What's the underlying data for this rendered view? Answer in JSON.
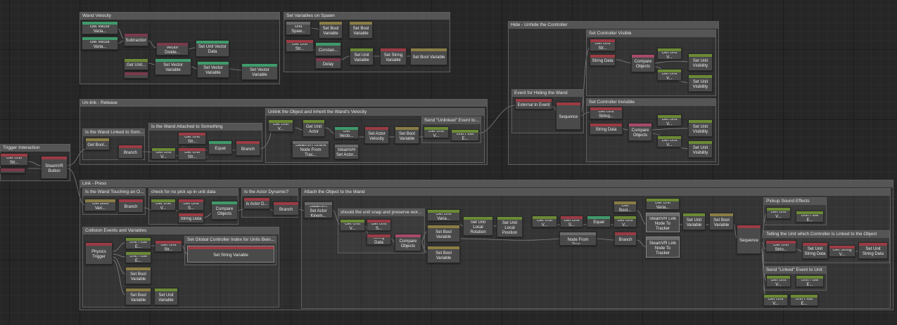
{
  "colors": {
    "green": "#3f9a6a",
    "lime": "#6b8a35",
    "olive": "#8a7d45",
    "red": "#9b3b44",
    "maroon": "#7a3a4c",
    "gray": "#6b6b6b",
    "wire": "#8c8c8c"
  },
  "groups": {
    "wand_velocity": "Wand Velocity",
    "set_vars_spawn": "Set Variables on Spawn",
    "hide_unhide": "Hide - Unhide the Controller",
    "set_ctrl_visible": "Set Controller Visible",
    "event_hiding": "Event for Hiding the Wand",
    "set_ctrl_invisible": "Set Controller Invisible",
    "unlink_release": "Un-link - Release",
    "unlink_object": "Unlink the Object and Inherit the Wand's Velocity",
    "send_unlinked": "Send \"Unlinked\" Event to...",
    "is_wand_linked": "Is the Wand Linked to Som...",
    "is_wand_attached": "Is the Wand Attached to Something",
    "trigger_interaction": "Trigger Interaction",
    "link_press": "Link - Press",
    "is_wand_touching": "Is the Wand Touching an O...",
    "check_no_pickup": "check for no pick up in unit data",
    "is_actor_dynamic": "Is the Actor Dynamic?",
    "attach_object": "Attach the Object to the Wand",
    "unit_snap": "should the unit snap and preserve wor...",
    "pickup_sfx": "Pickup Sound Effects",
    "telling_unit": "Telling the Unit which Controller is Linked to the Object",
    "send_linked": "Send \"Linked\" Event to Unit",
    "collision_events": "Collision Events and Variables",
    "set_global_ctrl": "Set Global Controller Index for Units Bein..."
  },
  "nodes": {
    "wv_get_vec_1": "Get Vector Varia...",
    "wv_get_vec_2": "Get Vector Varia...",
    "wv_subtraction": "Subtraction",
    "wv_vector_divide": "Vector Divide...",
    "wv_set_unit_vec": "Set Unit Vector Data",
    "wv_get_unit": "Get Unit...",
    "wv_set_vec_1": "Set Vector Variable",
    "wv_set_vec_2": "Set Vector Variable",
    "wv_set_vec_3": "Set Vector Variable",
    "sv_unit_spawn": "Unit Spaw...",
    "sv_set_bool_1": "Set Bool Variable",
    "sv_set_bool_2": "Set Bool Variable",
    "sv_get_unit_str": "Get Unit Str...",
    "sv_constant": "Constan...",
    "sv_delay": "Delay",
    "sv_set_unit_var": "Set Unit Variable",
    "sv_set_string": "Set String Variable",
    "sv_set_bool_3": "Set Bool Variable",
    "hu_external_event": "External In Event",
    "hu_sequence": "Sequence",
    "cv_get_unit_str": "Get Unit Str...",
    "cv_string_data": "String Data",
    "cv_compare": "Compare Objects",
    "cv_get_unit_v1": "Get Unit V...",
    "cv_get_unit_v2": "Get Unit V...",
    "cv_set_vis_1": "Set Unit Visibility",
    "cv_set_vis_2": "Set Unit Visibility",
    "ci_get_unit_str": "Get Unit String...",
    "ci_string_data": "String Data",
    "ci_compare": "Compare Objects",
    "ci_get_unit_v1": "Get Unit V...",
    "ci_get_unit_v2": "Get Unit V...",
    "ci_set_vis_1": "Set Unit Visibility",
    "ci_set_vis_2": "Set Unit Visibility",
    "ur_get_bool": "Get Bool...",
    "ur_branch_1": "Branch",
    "ur_get_unit_v": "Get Unit V...",
    "ur_get_unit_str_1": "Get Unit Str...",
    "ur_get_unit_str_2": "Get Unit Str...",
    "ur_equal": "Equal",
    "ur_branch_2": "Branch",
    "uo_get_unit_v": "Get Unit V...",
    "uo_get_unit_actor": "Get Unit Actor",
    "uo_steamvr_unlink": "SteamVR Unlink Node From Trac...",
    "uo_get_vecto": "Get Vecto...",
    "uo_set_actor_vel": "Set Actor Velocity",
    "uo_steamvr_set_actor": "SteamVR Set Actor...",
    "uo_set_bool": "Set Bool Variable",
    "uo_get_unit_v2": "Get Unit V...",
    "uo_unit_flow": "Unit Flow E...",
    "ti_get_unit_str": "Get Unit Str...",
    "ti_steamvr_button": "SteamVR Button",
    "lp_get_bool_var": "Get Bool Vari...",
    "lp_branch_1": "Branch",
    "lp_get_unit_v": "Get Unit V...",
    "lp_get_unit_s": "Get Unit S...",
    "lp_string_data": "String Data",
    "lp_compare": "Compare Objects",
    "lp_is_actor_d": "Is Actor D...",
    "lp_branch_2": "Branch",
    "at_steamvr_set_actor": "SteamVR Set Actor Kinem...",
    "us_get_unit_v": "Get Unit V...",
    "us_get_unit_s": "Get Unit S...",
    "us_string_data": "String Data",
    "us_compare": "Compare Objects",
    "at_get_unit_varia": "Get Unit Varia...",
    "at_set_bool_1": "Set Bool Variable",
    "at_set_bool_2": "Set Bool Variable",
    "at_set_local_rot": "Set Unit Local Rotation",
    "at_set_local_pos": "Set Unit Local Position",
    "at_get_unit_v1": "Get Unit V...",
    "at_get_unit_s": "Get Unit S...",
    "at_equal": "Equal",
    "at_get_unit_v2": "Get Unit V...",
    "at_steamvr_unlink": "SteamVR Unlink Node From Trac...",
    "at_get_bool": "Get Bool...",
    "at_branch": "Branch",
    "at_get_unit_varia_2": "Get Unit Varia...",
    "at_steamvr_link_1": "SteamVR Link Node To Tracker",
    "at_steamvr_link_2": "SteamVR Link Node To Tracker",
    "at_set_unit_var_1": "Set Unit Variable",
    "at_set_bool_3": "Set Bool Variable",
    "at_sequence": "Sequence",
    "ps_get_unit_v": "Get Unit V...",
    "ps_unit_flow": "Unit Flow E...",
    "tu_get_unit_strin": "Get Unit Strin...",
    "tu_set_unit_str": "Set Unit String Data",
    "tu_get_string_v": "Get String V...",
    "tu_set_unit_str_2": "Set Unit String Data",
    "sl_get_unit_v": "Get Unit V...",
    "sl_unit_flow": "Unit Flow E...",
    "bt_get_unit_v": "Get Unit V...",
    "bt_unit_flow": "Unit Flow E...",
    "ce_physics_trigger": "Physics Trigger",
    "ce_unit_flow_1": "Unit Flow E...",
    "ce_unit_flow_2": "Unit Flow E...",
    "ce_get_unit_str": "Get Unit Str...",
    "ce_set_bool_1": "Set Bool Variable",
    "ce_set_bool_2": "Set Bool Variable",
    "ce_set_unit_var": "Set Unit Variable",
    "sg_set_string_var": "Set String Variable"
  }
}
